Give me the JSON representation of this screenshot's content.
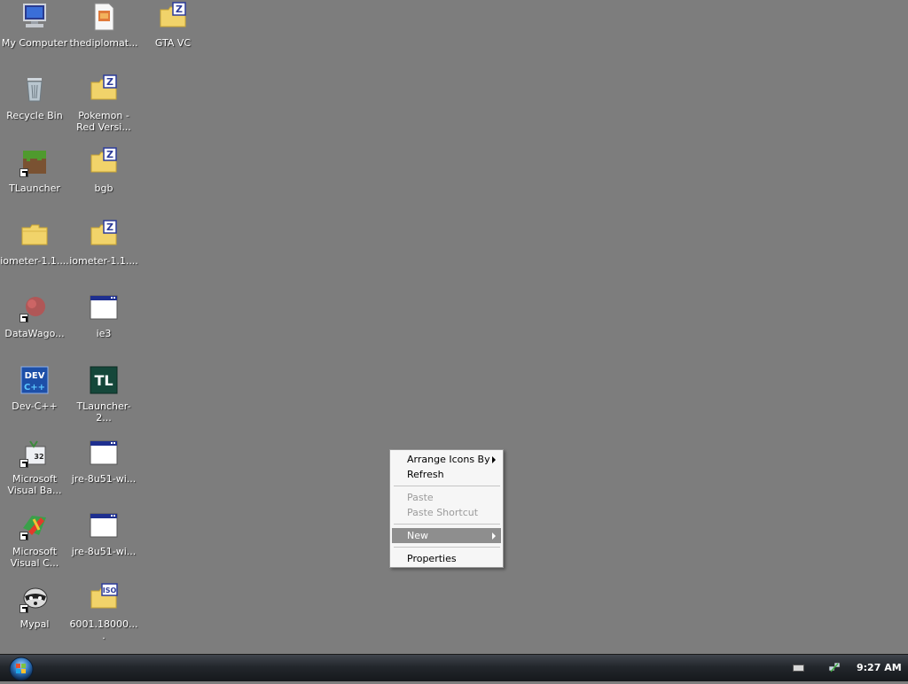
{
  "desktop_icons": [
    {
      "label": "My Computer",
      "icon": "computer-icon"
    },
    {
      "label": "thediplomat...",
      "icon": "document-icon"
    },
    {
      "label": "GTA VC",
      "icon": "zip-folder-icon"
    },
    {
      "label": "Recycle Bin",
      "icon": "recycle-bin-icon"
    },
    {
      "label": "Pokemon - Red Versi...",
      "icon": "zip-folder-icon"
    },
    {
      "label": "TLauncher",
      "icon": "grass-block-icon"
    },
    {
      "label": "bgb",
      "icon": "zip-folder-icon"
    },
    {
      "label": "iometer-1.1....",
      "icon": "folder-icon"
    },
    {
      "label": "iometer-1.1....",
      "icon": "zip-folder-icon"
    },
    {
      "label": "DataWago...",
      "icon": "red-blob-icon"
    },
    {
      "label": "ie3",
      "icon": "window-icon"
    },
    {
      "label": "Dev-C++",
      "icon": "dev-cpp-icon"
    },
    {
      "label": "TLauncher-2...",
      "icon": "tl-icon"
    },
    {
      "label": "Microsoft Visual Ba...",
      "icon": "visual-basic-icon"
    },
    {
      "label": "jre-8u51-wi...",
      "icon": "window-icon"
    },
    {
      "label": "Microsoft Visual C...",
      "icon": "visual-cpp-icon"
    },
    {
      "label": "jre-8u51-wi...",
      "icon": "window-icon"
    },
    {
      "label": "Mypal",
      "icon": "raccoon-icon"
    },
    {
      "label": "6001.18000....",
      "icon": "iso-folder-icon"
    }
  ],
  "context_menu": {
    "arrange_icons_by": "Arrange Icons By",
    "refresh": "Refresh",
    "paste": "Paste",
    "paste_shortcut": "Paste Shortcut",
    "new": "New",
    "properties": "Properties"
  },
  "taskbar": {
    "clock": "9:27 AM",
    "start_icon": "windows-orb-icon",
    "tray_icons": [
      "keyboard-icon",
      "network-icon"
    ]
  },
  "colors": {
    "desktop_bg": "#7d7d7d",
    "menu_highlight": "#8e8e8e"
  }
}
